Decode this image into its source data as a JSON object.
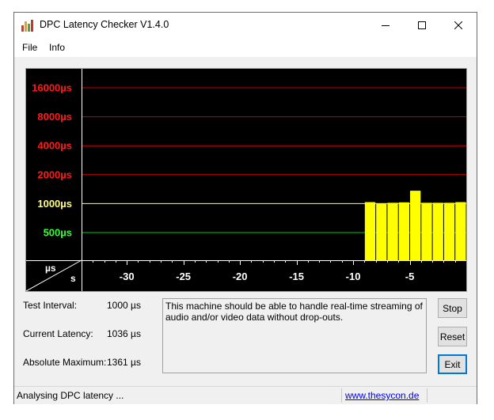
{
  "window": {
    "title": "DPC Latency Checker V1.4.0",
    "minimize_icon": "minimize-icon",
    "maximize_icon": "maximize-icon",
    "close_icon": "close-icon",
    "app_icon": "bar-chart-app-icon"
  },
  "menu": [
    {
      "label": "File"
    },
    {
      "label": "Info"
    }
  ],
  "chart": {
    "colors": {
      "background": "#000000",
      "red_label": "#ff1a1a",
      "red_line": "#cc0000",
      "yellow_label": "#ffff80",
      "yellow_line": "#ffff80",
      "green_label": "#33ff33",
      "green_line": "#00cc00",
      "bar": "#ffff00",
      "axis_text": "#ffffff"
    },
    "corner_label_top": "µs",
    "corner_label_bottom": "s"
  },
  "chart_data": {
    "type": "bar",
    "y_scale": "log",
    "y_unit": "µs",
    "y_ticks": [
      {
        "value": 16000,
        "label": "16000µs",
        "color": "red"
      },
      {
        "value": 8000,
        "label": "8000µs",
        "color": "red"
      },
      {
        "value": 4000,
        "label": "4000µs",
        "color": "red"
      },
      {
        "value": 2000,
        "label": "2000µs",
        "color": "red"
      },
      {
        "value": 1000,
        "label": "1000µs",
        "color": "yellow"
      },
      {
        "value": 500,
        "label": "500µs",
        "color": "green"
      }
    ],
    "x_ticks": [
      -30,
      -25,
      -20,
      -15,
      -10,
      -5
    ],
    "x_range": [
      -34,
      0
    ],
    "x_unit": "s",
    "bars": [
      {
        "x": -8.5,
        "value": 1036
      },
      {
        "x": -7.5,
        "value": 1010
      },
      {
        "x": -6.5,
        "value": 1020
      },
      {
        "x": -5.5,
        "value": 1030
      },
      {
        "x": -4.5,
        "value": 1361
      },
      {
        "x": -3.5,
        "value": 1020
      },
      {
        "x": -2.5,
        "value": 1020
      },
      {
        "x": -1.5,
        "value": 1020
      },
      {
        "x": -0.5,
        "value": 1036
      }
    ]
  },
  "info": {
    "test_interval_label": "Test Interval:",
    "test_interval_value": "1000 µs",
    "current_latency_label": "Current Latency:",
    "current_latency_value": "1036 µs",
    "absolute_maximum_label": "Absolute Maximum:",
    "absolute_maximum_value": "1361 µs"
  },
  "message": "This machine should be able to handle real-time streaming of audio and/or video data without drop-outs.",
  "buttons": {
    "stop": "Stop",
    "reset": "Reset",
    "exit": "Exit"
  },
  "status": {
    "text": "Analysing DPC latency ...",
    "link": "www.thesycon.de"
  }
}
